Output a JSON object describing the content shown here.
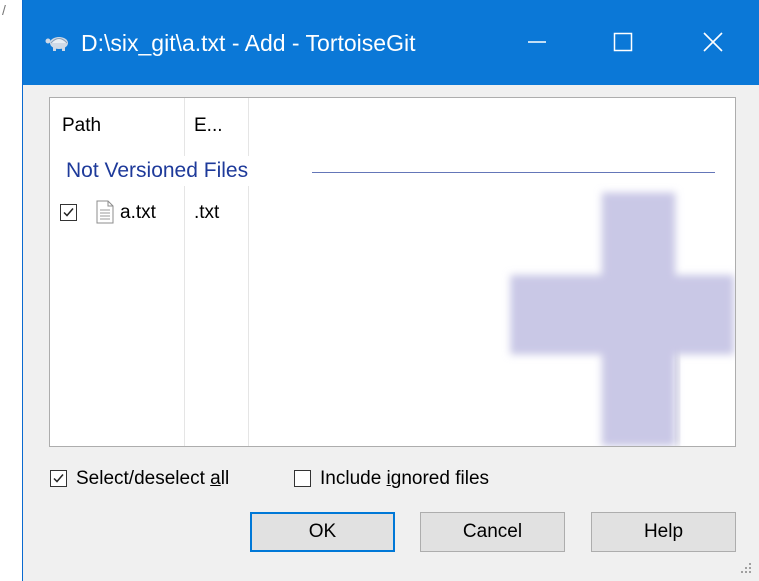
{
  "window": {
    "title": "D:\\six_git\\a.txt - Add - TortoiseGit",
    "app_icon": "tortoise-icon",
    "controls": [
      "minimize-icon",
      "maximize-icon",
      "close-icon"
    ]
  },
  "file_list": {
    "columns": [
      "Path",
      "E..."
    ],
    "group_label": "Not Versioned Files",
    "rows": [
      {
        "checked": true,
        "icon": "file-icon",
        "path": "a.txt",
        "extension": ".txt"
      }
    ],
    "watermark_icon": "add-plus-icon"
  },
  "options": {
    "select_all": {
      "label_before": "Select/deselect ",
      "label_underlined": "a",
      "label_after": "ll",
      "checked": true
    },
    "include_ignored": {
      "label_before": "Include ",
      "label_underlined": "i",
      "label_after": "gnored files",
      "checked": false
    }
  },
  "buttons": {
    "ok": "OK",
    "cancel": "Cancel",
    "help": "Help"
  },
  "colors": {
    "titlebar": "#0b78d7",
    "group_label": "#1e3a9a",
    "default_button_border": "#0078d7",
    "watermark": "#c8c6e6"
  }
}
